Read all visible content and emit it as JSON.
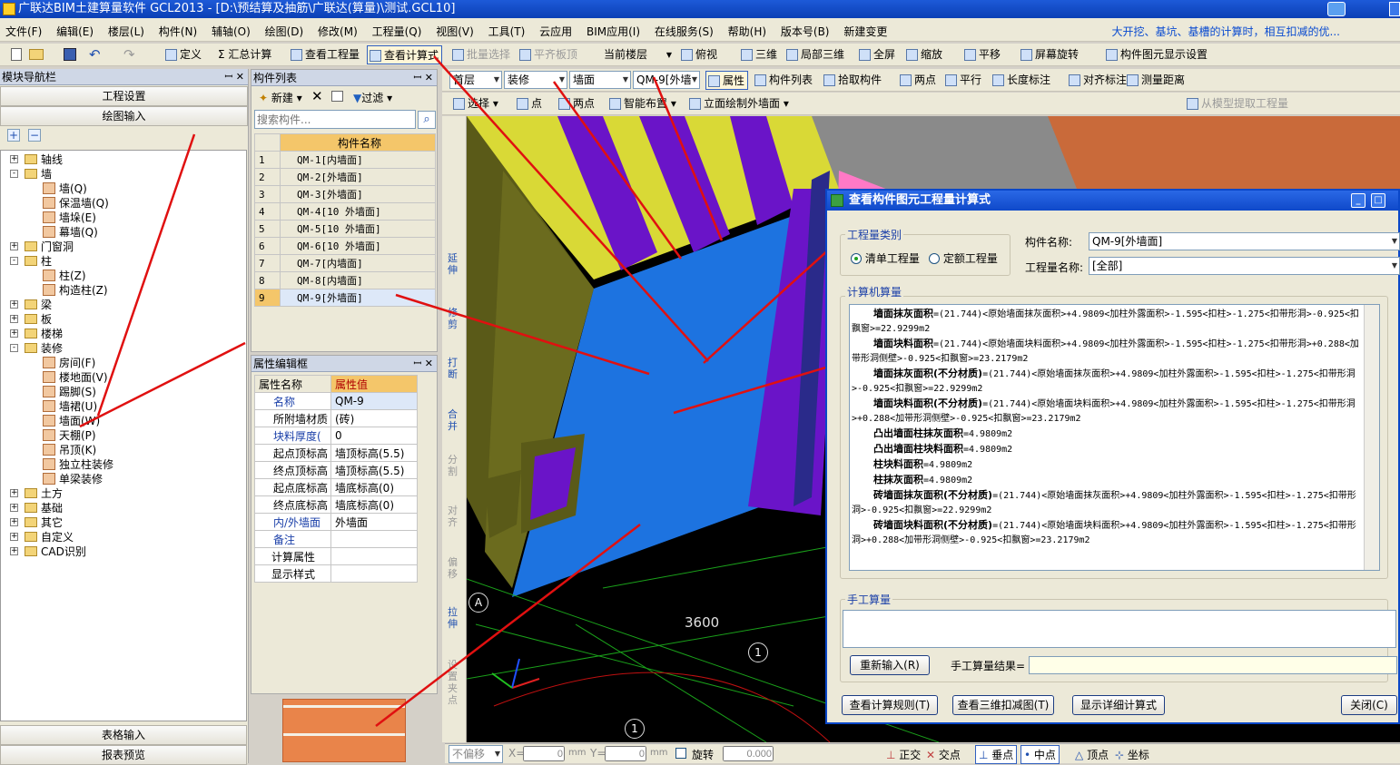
{
  "window": {
    "title": "广联达BIM土建算量软件 GCL2013 - [D:\\预结算及抽筋\\广联达(算量)\\测试.GCL10]"
  },
  "menu": {
    "items": [
      "文件(F)",
      "编辑(E)",
      "楼层(L)",
      "构件(N)",
      "辅轴(O)",
      "绘图(D)",
      "修改(M)",
      "工程量(Q)",
      "视图(V)",
      "工具(T)",
      "云应用",
      "BIM应用(I)",
      "在线服务(S)",
      "帮助(H)",
      "版本号(B)",
      "新建变更"
    ],
    "hint": "大开挖、基坑、基槽的计算时，相互扣减的优..."
  },
  "toolbar1": {
    "define": "定义",
    "sum": "Σ 汇总计算",
    "view_project": "查看工程量",
    "view_formula": "查看计算式",
    "batch_select": "批量选择",
    "level_board": "平齐板顶",
    "current_floor": "当前楼层",
    "view_top": "俯视",
    "three_d": "三维",
    "partial_3d": "局部三维",
    "fullscreen": "全屏",
    "zoom": "缩放",
    "pan": "平移",
    "rotate": "屏幕旋转",
    "display_settings": "构件图元显示设置"
  },
  "toolbar2": {
    "floor": "首层",
    "category": "装修",
    "type": "墙面",
    "component": "QM-9[外墙",
    "properties": "属性",
    "component_list": "构件列表",
    "pick": "拾取构件",
    "two_points": "两点",
    "parallel": "平行",
    "length_mark": "长度标注",
    "align_mark": "对齐标注",
    "measure": "测量距离"
  },
  "toolbar3": {
    "select": "选择",
    "point": "点",
    "two_points": "两点",
    "smart_layout": "智能布置",
    "elevation": "立面绘制外墙面",
    "extract": "从模型提取工程量"
  },
  "nav": {
    "title": "模块导航栏",
    "project_settings": "工程设置",
    "drawing_input": "绘图输入",
    "table_input": "表格输入",
    "report_preview": "报表预览"
  },
  "tree": [
    {
      "label": "轴线",
      "level": 0,
      "pm": "+"
    },
    {
      "label": "墙",
      "level": 0,
      "pm": "-"
    },
    {
      "label": "墙(Q)",
      "level": 1
    },
    {
      "label": "保温墙(Q)",
      "level": 1
    },
    {
      "label": "墙垛(E)",
      "level": 1
    },
    {
      "label": "幕墙(Q)",
      "level": 1
    },
    {
      "label": "门窗洞",
      "level": 0,
      "pm": "+"
    },
    {
      "label": "柱",
      "level": 0,
      "pm": "-"
    },
    {
      "label": "柱(Z)",
      "level": 1
    },
    {
      "label": "构造柱(Z)",
      "level": 1
    },
    {
      "label": "梁",
      "level": 0,
      "pm": "+"
    },
    {
      "label": "板",
      "level": 0,
      "pm": "+"
    },
    {
      "label": "楼梯",
      "level": 0,
      "pm": "+"
    },
    {
      "label": "装修",
      "level": 0,
      "pm": "-"
    },
    {
      "label": "房间(F)",
      "level": 1
    },
    {
      "label": "楼地面(V)",
      "level": 1
    },
    {
      "label": "踢脚(S)",
      "level": 1
    },
    {
      "label": "墙裙(U)",
      "level": 1
    },
    {
      "label": "墙面(W)",
      "level": 1
    },
    {
      "label": "天棚(P)",
      "level": 1
    },
    {
      "label": "吊顶(K)",
      "level": 1
    },
    {
      "label": "独立柱装修",
      "level": 1
    },
    {
      "label": "单梁装修",
      "level": 1
    },
    {
      "label": "土方",
      "level": 0,
      "pm": "+"
    },
    {
      "label": "基础",
      "level": 0,
      "pm": "+"
    },
    {
      "label": "其它",
      "level": 0,
      "pm": "+"
    },
    {
      "label": "自定义",
      "level": 0,
      "pm": "+"
    },
    {
      "label": "CAD识别",
      "level": 0,
      "pm": "+"
    }
  ],
  "component_list": {
    "title": "构件列表",
    "new": "新建",
    "filter": "过滤",
    "search_placeholder": "搜索构件...",
    "header": "构件名称",
    "rows": [
      "QM-1[内墙面]",
      "QM-2[外墙面]",
      "QM-3[外墙面]",
      "QM-4[10 外墙面]",
      "QM-5[10 外墙面]",
      "QM-6[10 外墙面]",
      "QM-7[内墙面]",
      "QM-8[内墙面]",
      "QM-9[外墙面]"
    ]
  },
  "props": {
    "title": "属性编辑框",
    "col_name": "属性名称",
    "col_value": "属性值",
    "rows": [
      [
        "名称",
        "QM-9"
      ],
      [
        "所附墙材质",
        "(砖)"
      ],
      [
        "块料厚度(",
        "0"
      ],
      [
        "起点顶标高",
        "墙顶标高(5.5)"
      ],
      [
        "终点顶标高",
        "墙顶标高(5.5)"
      ],
      [
        "起点底标高",
        "墙底标高(0)"
      ],
      [
        "终点底标高",
        "墙底标高(0)"
      ],
      [
        "内/外墙面",
        "外墙面"
      ],
      [
        "备注",
        ""
      ],
      [
        "计算属性",
        ""
      ],
      [
        "显示样式",
        ""
      ]
    ]
  },
  "canvas": {
    "dim_label": "3600",
    "axis_a": "A",
    "axis_1": "1",
    "axis_1b": "1"
  },
  "dialog": {
    "title": "查看构件图元工程量计算式",
    "qty_type_label": "工程量类别",
    "radio_list": "清单工程量",
    "radio_quota": "定额工程量",
    "comp_name_label": "构件名称:",
    "comp_name_value": "QM-9[外墙面]",
    "qty_name_label": "工程量名称:",
    "qty_name_value": "[全部]",
    "computer_label": "计算机算量",
    "lines": [
      {
        "name": "墙面抹灰面积",
        "text": "=(21.744)<原始墙面抹灰面积>+4.9809<加柱外露面积>-1.595<扣柱>-1.275<扣带形洞>-0.925<扣飘窗>=22.9299m2"
      },
      {
        "name": "墙面块料面积",
        "text": "=(21.744)<原始墙面块料面积>+4.9809<加柱外露面积>-1.595<扣柱>-1.275<扣带形洞>+0.288<加带形洞侧壁>-0.925<扣飘窗>=23.2179m2"
      },
      {
        "name": "墙面抹灰面积(不分材质)",
        "text": "=(21.744)<原始墙面抹灰面积>+4.9809<加柱外露面积>-1.595<扣柱>-1.275<扣带形洞>-0.925<扣飘窗>=22.9299m2"
      },
      {
        "name": "墙面块料面积(不分材质)",
        "text": "=(21.744)<原始墙面块料面积>+4.9809<加柱外露面积>-1.595<扣柱>-1.275<扣带形洞>+0.288<加带形洞侧壁>-0.925<扣飘窗>=23.2179m2"
      },
      {
        "name": "凸出墙面柱抹灰面积",
        "text": "=4.9809m2"
      },
      {
        "name": "凸出墙面柱块料面积",
        "text": "=4.9809m2"
      },
      {
        "name": "柱块料面积",
        "text": "=4.9809m2"
      },
      {
        "name": "柱抹灰面积",
        "text": "=4.9809m2"
      },
      {
        "name": "砖墙面抹灰面积(不分材质)",
        "text": "=(21.744)<原始墙面抹灰面积>+4.9809<加柱外露面积>-1.595<扣柱>-1.275<扣带形洞>-0.925<扣飘窗>=22.9299m2"
      },
      {
        "name": "砖墙面块料面积(不分材质)",
        "text": "=(21.744)<原始墙面块料面积>+4.9809<加柱外露面积>-1.595<扣柱>-1.275<扣带形洞>+0.288<加带形洞侧壁>-0.925<扣飘窗>=23.2179m2"
      }
    ],
    "manual_label": "手工算量",
    "reinput": "重新输入(R)",
    "manual_result_label": "手工算量结果=",
    "btn_rules": "查看计算规则(T)",
    "btn_3d": "查看三维扣减图(T)",
    "btn_detail": "显示详细计算式",
    "btn_close": "关闭(C)"
  },
  "status": {
    "no_offset": "不偏移",
    "x_label": "X=",
    "x_val": "0",
    "y_label": "Y=",
    "y_val": "0",
    "unit": "mm",
    "rotate": "旋转",
    "rotate_val": "0.000",
    "ortho": "正交",
    "intersection": "交点",
    "perpendicular": "垂点",
    "midpoint": "中点",
    "vertex": "顶点",
    "coordinate": "坐标"
  }
}
